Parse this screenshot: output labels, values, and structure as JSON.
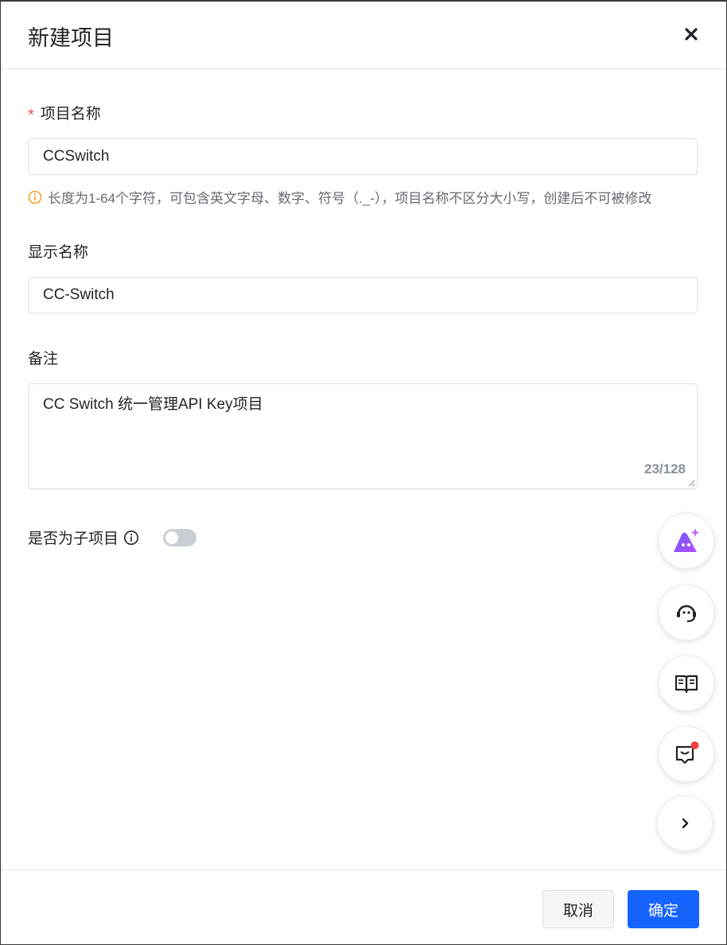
{
  "dialog": {
    "title": "新建项目",
    "close_icon": "close-icon"
  },
  "form": {
    "project_name": {
      "required_mark": "*",
      "label": "项目名称",
      "value": "CCSwitch",
      "hint": "长度为1-64个字符，可包含英文字母、数字、符号（._-），项目名称不区分大小写，创建后不可被修改",
      "hint_icon": "info-circle-icon",
      "hint_icon_color": "#f0a020"
    },
    "display_name": {
      "label": "显示名称",
      "value": "CC-Switch"
    },
    "remark": {
      "label": "备注",
      "value": "CC Switch 统一管理API Key项目",
      "counter": "23/128"
    },
    "sub_project": {
      "label": "是否为子项目",
      "info_icon": "info-icon",
      "toggle_on": false
    }
  },
  "floating_buttons": [
    {
      "name": "ai-assistant-icon"
    },
    {
      "name": "customer-service-icon"
    },
    {
      "name": "docs-book-icon"
    },
    {
      "name": "feedback-message-icon",
      "badge_color": "#f53f3f"
    },
    {
      "name": "chevron-right-icon"
    }
  ],
  "footer": {
    "cancel_label": "取消",
    "confirm_label": "确定"
  },
  "colors": {
    "primary": "#1664ff",
    "required": "#e34d59"
  }
}
